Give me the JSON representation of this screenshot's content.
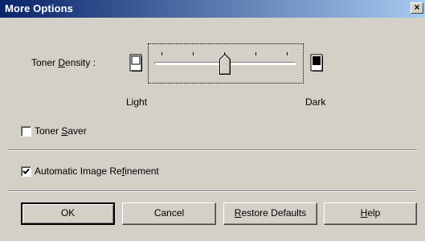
{
  "window": {
    "title": "More Options",
    "close_glyph": "×"
  },
  "toner_density": {
    "label_prefix": "Toner ",
    "label_mnemonic": "D",
    "label_rest": "ensity :",
    "light_label": "Light",
    "dark_label": "Dark",
    "light_icon": "light-page-icon",
    "dark_icon": "dark-page-icon",
    "slider_level": 0.5
  },
  "toner_saver": {
    "label_prefix": "Toner ",
    "label_mnemonic": "S",
    "label_rest": "aver",
    "checked": false
  },
  "auto_refinement": {
    "label_prefix": "Automatic Image Re",
    "label_mnemonic": "f",
    "label_rest": "inement",
    "checked": true
  },
  "buttons": {
    "ok": "OK",
    "cancel": "Cancel",
    "restore_mnemonic": "R",
    "restore_rest": "estore Defaults",
    "help_mnemonic": "H",
    "help_rest": "elp"
  },
  "colors": {
    "face": "#d4d0c8",
    "title_start": "#0a246a",
    "title_end": "#a6caf0"
  }
}
